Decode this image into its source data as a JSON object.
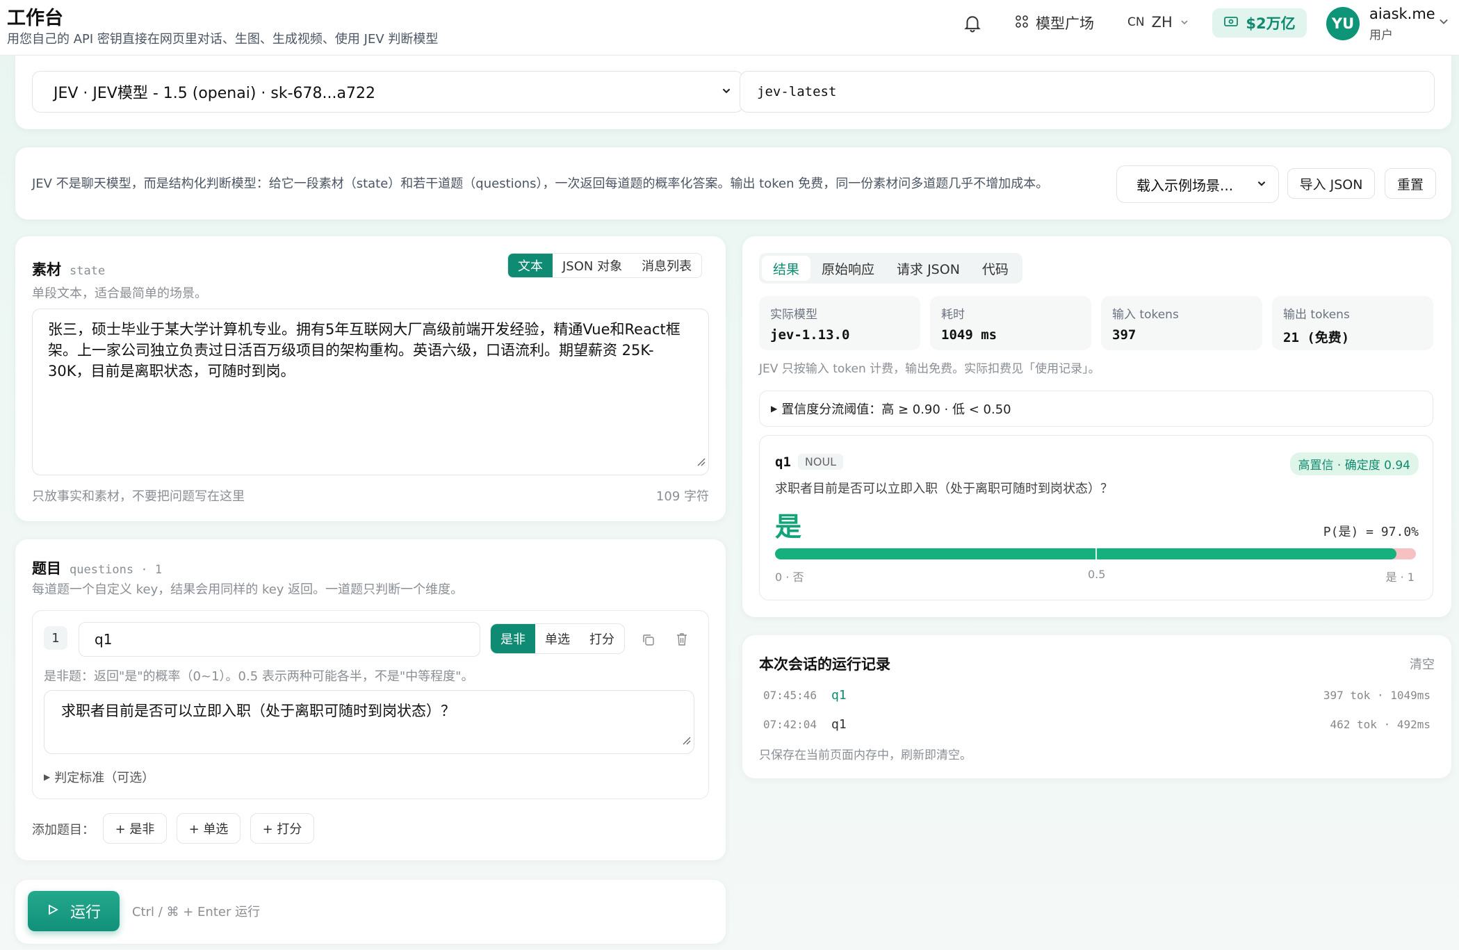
{
  "header": {
    "title": "工作台",
    "subtitle": "用您自己的 API 密钥直接在网页里对话、生图、生成视频、使用 JEV 判断模型",
    "market_label": "模型广场",
    "lang_region": "CN",
    "lang_code": "ZH",
    "balance": "$2万亿",
    "avatar_initials": "YU",
    "username": "aiask.me",
    "role": "用户"
  },
  "config": {
    "key_select": "JEV · JEV模型 - 1.5 (openai) · sk-678...a722",
    "model_input": "jev-latest"
  },
  "intro": {
    "text": "JEV 不是聊天模型，而是结构化判断模型：给它一段素材（state）和若干道题（questions），一次返回每道题的概率化答案。输出 token 免费，同一份素材问多道题几乎不增加成本。",
    "scenario_select": "载入示例场景...",
    "import_label": "导入 JSON",
    "reset_label": "重置"
  },
  "state": {
    "title": "素材",
    "tag": "state",
    "modes": [
      "文本",
      "JSON 对象",
      "消息列表"
    ],
    "active_mode": 0,
    "hint": "单段文本，适合最简单的场景。",
    "content": "张三，硕士毕业于某大学计算机专业。拥有5年互联网大厂高级前端开发经验，精通Vue和React框架。上一家公司独立负责过日活百万级项目的架构重构。英语六级，口语流利。期望薪资 25K-30K，目前是离职状态，可随时到岗。",
    "footer_hint": "只放事实和素材，不要把问题写在这里",
    "char_count": "109 字符"
  },
  "questions": {
    "title": "题目",
    "tag": "questions · 1",
    "hint": "每道题一个自定义 key，结果会用同样的 key 返回。一道题只判断一个维度。",
    "items": [
      {
        "index": "1",
        "key": "q1",
        "types": [
          "是非",
          "单选",
          "打分"
        ],
        "active_type": 0,
        "type_hint": "是非题：返回\"是\"的概率（0~1）。0.5 表示两种可能各半，不是\"中等程度\"。",
        "text": "求职者目前是否可以立即入职（处于离职可随时到岗状态）？",
        "criteria_label": "判定标准（可选）"
      }
    ],
    "add_label": "添加题目：",
    "add_buttons": [
      "+ 是非",
      "+ 单选",
      "+ 打分"
    ]
  },
  "run": {
    "label": "运行",
    "shortcut": "Ctrl / ⌘ + Enter 运行"
  },
  "results": {
    "tabs": [
      "结果",
      "原始响应",
      "请求 JSON",
      "代码"
    ],
    "active_tab": 0,
    "stats": [
      {
        "label": "实际模型",
        "value": "jev-1.13.0"
      },
      {
        "label": "耗时",
        "value": "1049 ms"
      },
      {
        "label": "输入 tokens",
        "value": "397"
      },
      {
        "label": "输出 tokens",
        "value": "21 (免费)"
      }
    ],
    "billing_note": "JEV 只按输入 token 计费，输出免费。实际扣费见「使用记录」。",
    "threshold_label": "置信度分流阈值：高 ≥ 0.90 · 低 < 0.50",
    "answer": {
      "key": "q1",
      "type_tag": "NOUL",
      "badge": "高置信 · 确定度 0.94",
      "question": "求职者目前是否可以立即入职（处于离职可随时到岗状态）？",
      "verdict": "是",
      "prob_label": "P(是) = 97.0%",
      "probability": 0.97,
      "scale_left": "0 · 否",
      "scale_mid": "0.5",
      "scale_right": "是 · 1"
    }
  },
  "history": {
    "title": "本次会话的运行记录",
    "clear_label": "清空",
    "rows": [
      {
        "time": "07:45:46",
        "key": "q1",
        "stats": "397 tok · 1049ms"
      },
      {
        "time": "07:42:04",
        "key": "q1",
        "stats": "462 tok · 492ms"
      }
    ],
    "note": "只保存在当前页面内存中，刷新即清空。"
  },
  "colors": {
    "brand": "#0f8a73",
    "bar_fill": "#16b07e",
    "bar_rest": "#f7c1c4",
    "badge_bg": "#dff5ea"
  }
}
